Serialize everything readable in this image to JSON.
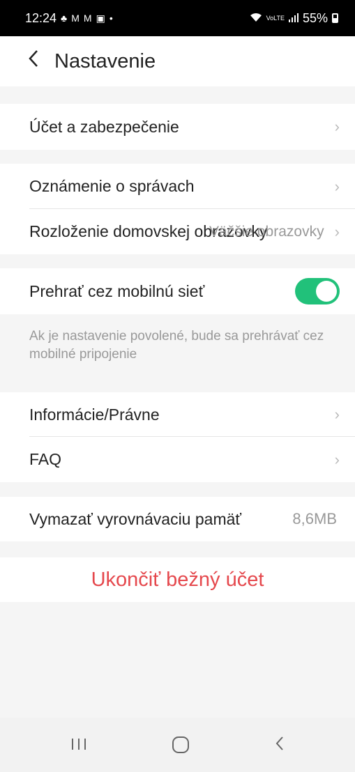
{
  "status_bar": {
    "time": "12:24",
    "notification_icons": [
      "♣",
      "M",
      "M",
      "▣",
      "•"
    ],
    "network": "VoLTE",
    "battery": "55%"
  },
  "header": {
    "title": "Nastavenie"
  },
  "rows": {
    "account": "Účet a zabezpečenie",
    "notifications": "Oznámenie o správach",
    "home_layout": "Rozloženie domovskej obrazovky",
    "home_layout_overlay": "Väčšie obrazovky",
    "mobile_play": "Prehrať cez mobilnú sieť",
    "mobile_play_enabled": true,
    "mobile_play_hint": "Ak je nastavenie povolené, bude sa prehrávať cez mobilné pripojenie",
    "info_legal": "Informácie/Právne",
    "faq": "FAQ",
    "clear_cache": "Vymazať vyrovnávaciu pamäť",
    "cache_size": "8,6MB"
  },
  "logout": {
    "label": "Ukončiť bežný účet"
  },
  "colors": {
    "toggle_on": "#21c17a",
    "logout_text": "#e5484d"
  }
}
